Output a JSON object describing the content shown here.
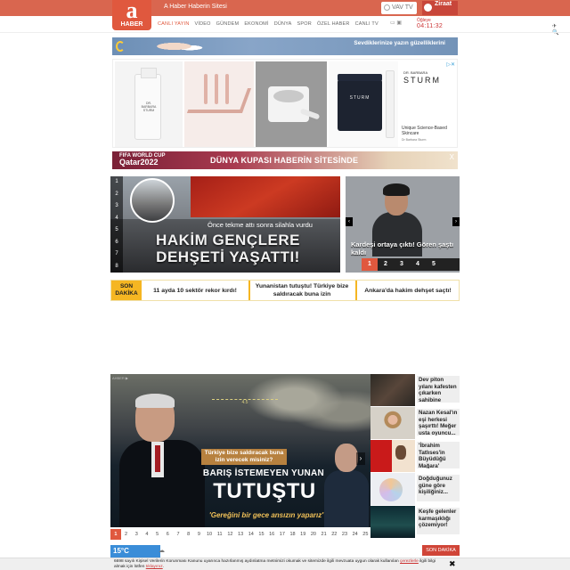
{
  "header": {
    "logo_letter": "a",
    "logo_sub": "HABER",
    "slogan": "A Haber Haberin Sitesi",
    "vav_label": "VAV TV",
    "ziraat_label": "Ziraat",
    "nav": [
      "CANLI YAYIN",
      "VİDEO",
      "GÜNDEM",
      "EKONOMİ",
      "DÜNYA",
      "SPOR",
      "ÖZEL HABER",
      "CANLI TV"
    ],
    "date_label": "Öğleye",
    "time": "04:11:32",
    "icons_text": "✈ 🔍"
  },
  "ads": {
    "top_banner": "Sevdiklerinize yazın güzelliklerini",
    "sturm_brand_small": "DR. BARBARA",
    "sturm_brand": "STURM",
    "sturm_desc": "Unique Science-Based Skincare",
    "sturm_small": "Dr Barbara Sturm",
    "jar_label": "STURM",
    "bottle_label": "DR. BARBARA STURM",
    "adchoice": "▷✕",
    "wc_line1": "FIFA WORLD CUP",
    "wc_line2": "Qatar2022",
    "wc_title": "DÜNYA KUPASI HABERİN SİTESİNDE",
    "wc_close": "X"
  },
  "slider": {
    "numbers": [
      "1",
      "2",
      "3",
      "4",
      "5",
      "6",
      "7",
      "8"
    ],
    "subtitle": "Önce tekme attı sonra silahla vurdu",
    "headline": "HAKİM GENÇLERE DEHŞETİ YAŞATTI!",
    "side_caption": "Kardeşi ortaya çıktı! Gören şaştı kaldı",
    "side_pages": [
      "1",
      "2",
      "3",
      "4",
      "5"
    ],
    "prev": "‹",
    "next": "›"
  },
  "son_dakika": {
    "badge": "SON DAKİKA",
    "items": [
      "11 ayda 10 sektör rekor kırdı!",
      "Yunanistan tutuştu! Türkiye bize saldıracak buna izin",
      "Ankara'da hakim dehşet saçtı!"
    ]
  },
  "manset": {
    "corner": "AHBER ▶",
    "reticle": "4.5",
    "kicker": "Türkiye bize saldıracak buna izin verecek misiniz?",
    "line1": "BARIŞ İSTEMEYEN YUNAN",
    "line2": "TUTUŞTU",
    "quote": "'Gereğini bir gece ansızın yaparız'",
    "next": "›",
    "pages": [
      "1",
      "2",
      "3",
      "4",
      "5",
      "6",
      "7",
      "8",
      "9",
      "10",
      "11",
      "12",
      "13",
      "14",
      "15",
      "16",
      "17",
      "18",
      "19",
      "20",
      "21",
      "22",
      "23",
      "24",
      "25"
    ]
  },
  "weather": {
    "temp": "15°C",
    "icon": "☁"
  },
  "son_dakika_btn": "SON DAKİKA",
  "right_list": [
    "Dev piton yılanı kafesten çıkarken sahibine",
    "Nazan Kesal'ın eşi herkesi şaşırttı! Meğer usta oyuncu...",
    "'İbrahim Tatlıses'in Büyüdüğü Mağara' müzesi",
    "Doğduğunuz güne göre kişiliğiniz...",
    "Keşfe gelenler karmaşıklığı çözemiyor!"
  ],
  "cookie": {
    "text": "6698 sayılı Kişisel Verilerin Korunması Kanunu uyarınca hazırlanmış aydınlatma metnimizi okumak ve sitemizde ilgili mevzuata uygun olarak kullanılan",
    "link1": "çerezlerle",
    "text2": "ilgili bilgi almak için lütfen",
    "link2": "tıklayınız",
    "close": "✖"
  }
}
